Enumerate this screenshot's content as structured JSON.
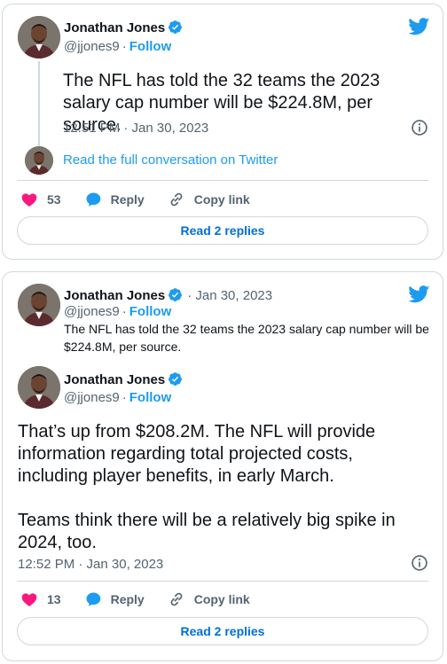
{
  "colors": {
    "accent": "#1d9bf0",
    "heart": "#f91880",
    "text": "#0f1419",
    "muted": "#536471",
    "border": "#cfd9de"
  },
  "card1": {
    "author": {
      "name": "Jonathan Jones",
      "handle": "@jjones9",
      "follow": "Follow"
    },
    "text": "The NFL has told the 32 teams the 2023 salary cap number will be $224.8M, per source.",
    "timestamp": "12:51 PM · Jan 30, 2023",
    "read_conversation": "Read the full conversation on Twitter",
    "likes": "53",
    "reply": "Reply",
    "copy_link": "Copy link",
    "read_replies": "Read 2 replies"
  },
  "card2": {
    "quoted": {
      "name": "Jonathan Jones",
      "date": "· Jan 30, 2023",
      "handle": "@jjones9",
      "follow": "Follow",
      "text": "The NFL has told the 32 teams the 2023 salary cap number will be $224.8M, per source."
    },
    "author": {
      "name": "Jonathan Jones",
      "handle": "@jjones9",
      "follow": "Follow"
    },
    "text": "That’s up from $208.2M. The NFL will provide information regarding total projected costs, including player benefits, in early March.\n\nTeams think there will be a relatively big spike in 2024, too.",
    "timestamp": "12:52 PM · Jan 30, 2023",
    "likes": "13",
    "reply": "Reply",
    "copy_link": "Copy link",
    "read_replies": "Read 2 replies"
  }
}
